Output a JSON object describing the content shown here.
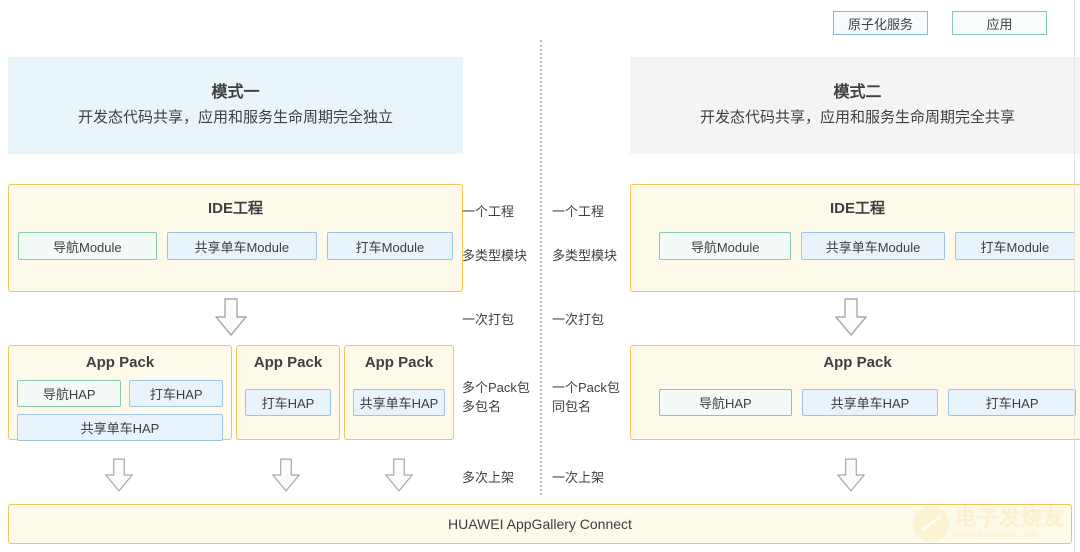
{
  "legend": {
    "items": [
      {
        "label": "原子化服务",
        "style": "atomic"
      },
      {
        "label": "应用",
        "style": "app"
      }
    ]
  },
  "columns": {
    "left": {
      "header": {
        "title": "模式一",
        "subtitle": "开发态代码共享，应用和服务生命周期完全独立"
      },
      "ide_project": {
        "title": "IDE工程",
        "modules": [
          {
            "label": "导航Module",
            "style": "green"
          },
          {
            "label": "共享单车Module",
            "style": "blue"
          },
          {
            "label": "打车Module",
            "style": "blue"
          }
        ]
      },
      "packs": [
        {
          "title": "App Pack",
          "rows": [
            [
              {
                "label": "导航HAP",
                "style": "green"
              },
              {
                "label": "打车HAP",
                "style": "blue"
              }
            ],
            [
              {
                "label": "共享单车HAP",
                "style": "blue"
              }
            ]
          ]
        },
        {
          "title": "App Pack",
          "rows": [
            [
              {
                "label": "打车HAP",
                "style": "blue"
              }
            ]
          ]
        },
        {
          "title": "App Pack",
          "rows": [
            [
              {
                "label": "共享单车HAP",
                "style": "blue"
              }
            ]
          ]
        }
      ],
      "annotations": {
        "one_project": "一个工程",
        "multi_module": "多类型模块",
        "one_build": "一次打包",
        "pack_note": "多个Pack包\n多包名",
        "publish": "多次上架"
      }
    },
    "right": {
      "header": {
        "title": "模式二",
        "subtitle": "开发态代码共享，应用和服务生命周期完全共享"
      },
      "ide_project": {
        "title": "IDE工程",
        "modules": [
          {
            "label": "导航Module",
            "style": "green"
          },
          {
            "label": "共享单车Module",
            "style": "blue"
          },
          {
            "label": "打车Module",
            "style": "blue"
          }
        ]
      },
      "packs": [
        {
          "title": "App Pack",
          "rows": [
            [
              {
                "label": "导航HAP",
                "style": "green"
              },
              {
                "label": "共享单车HAP",
                "style": "blue"
              },
              {
                "label": "打车HAP",
                "style": "blue"
              }
            ]
          ]
        }
      ],
      "annotations": {
        "one_project": "一个工程",
        "multi_module": "多类型模块",
        "one_build": "一次打包",
        "pack_note": "一个Pack包\n同包名",
        "publish": "一次上架"
      }
    }
  },
  "footer": {
    "label": "HUAWEI AppGallery Connect"
  },
  "watermark": {
    "cn": "电子发烧友",
    "en": "www.elecfans.com"
  },
  "colors": {
    "panel_border": "#f2c55c",
    "panel_bg": "#fdfaea",
    "green_border": "#86c9ac",
    "blue_border": "#9cc4e4",
    "header_left_bg": "#e9f4fb",
    "header_right_bg": "#f4f4f4"
  }
}
